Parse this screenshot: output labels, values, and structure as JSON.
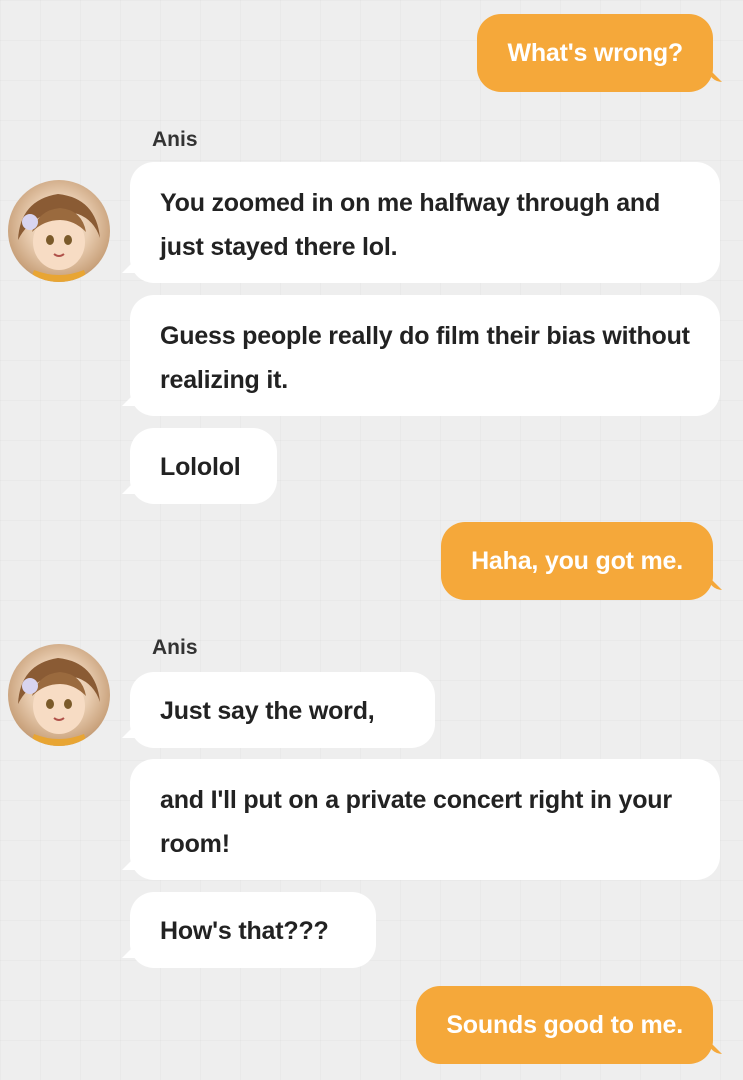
{
  "messages": [
    {
      "type": "out",
      "text": "What's wrong?"
    },
    {
      "type": "in_group",
      "sender": "Anis",
      "bubbles": [
        "You zoomed in on me halfway through and just stayed there lol.",
        "Guess people really do film their bias without realizing it.",
        "Lololol"
      ]
    },
    {
      "type": "out",
      "text": "Haha, you got me."
    },
    {
      "type": "in_group",
      "sender": "Anis",
      "bubbles": [
        "Just say the word,",
        "and I'll put on a private concert right in your room!",
        "How's that???"
      ]
    },
    {
      "type": "out",
      "text": "Sounds good to me."
    }
  ],
  "colors": {
    "outgoing_bubble": "#f5a83a",
    "incoming_bubble": "#ffffff",
    "background": "#eeeeee"
  },
  "icons": {
    "avatar": "anis-avatar-icon"
  }
}
